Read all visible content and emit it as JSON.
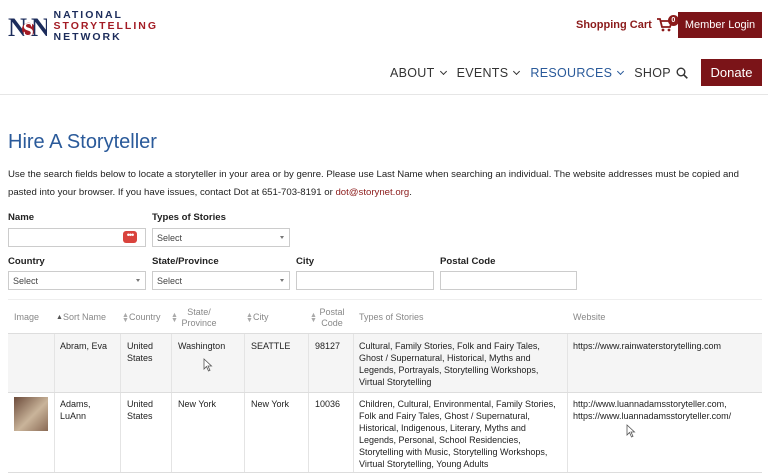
{
  "header": {
    "logo": {
      "line1": "NATIONAL",
      "line2": "STORYTELLING",
      "line3": "NETWORK"
    },
    "cart_label": "Shopping Cart",
    "cart_count": "0",
    "member_login": "Member Login",
    "nav": [
      {
        "label": "ABOUT",
        "dropdown": true
      },
      {
        "label": "EVENTS",
        "dropdown": true
      },
      {
        "label": "RESOURCES",
        "dropdown": true,
        "active": true
      },
      {
        "label": "SHOP",
        "dropdown": false
      }
    ],
    "donate": "Donate",
    "colors": {
      "brand_red": "#7b1418",
      "brand_blue": "#2a5a9a"
    }
  },
  "main": {
    "title": "Hire A Storyteller",
    "intro_text": "Use the search fields below to locate a storyteller in your area or by genre. Please use Last Name when searching an individual. The website addresses must be copied and pasted into your browser. If you have issues, contact Dot at 651-703-8191 or ",
    "intro_email": "dot@storynet.org",
    "intro_end": "."
  },
  "filters": {
    "name_label": "Name",
    "name_value": "",
    "types_label": "Types of Stories",
    "types_value": "Select",
    "country_label": "Country",
    "country_value": "Select",
    "state_label": "State/Province",
    "state_value": "Select",
    "city_label": "City",
    "city_value": "",
    "postal_label": "Postal Code",
    "postal_value": ""
  },
  "table": {
    "headers": {
      "image": "Image",
      "sort_name": "Sort Name",
      "country": "Country",
      "state": "State/ Province",
      "city": "City",
      "postal": "Postal Code",
      "types": "Types of Stories",
      "website": "Website"
    },
    "rows": [
      {
        "name": "Abram, Eva",
        "country": "United States",
        "state": "Washington",
        "city": "SEATTLE",
        "postal": "98127",
        "types": "Cultural, Family Stories, Folk and Fairy Tales, Ghost / Supernatural, Historical, Myths and Legends, Portrayals, Storytelling Workshops, Virtual Storytelling",
        "website": "https://www.rainwaterstorytelling.com"
      },
      {
        "name": "Adams, LuAnn",
        "country": "United States",
        "state": "New York",
        "city": "New York",
        "postal": "10036",
        "types": "Children, Cultural, Environmental, Family Stories, Folk and Fairy Tales, Ghost / Supernatural, Historical, Indigenous, Literary, Myths and Legends, Personal, School Residencies, Storytelling with Music, Storytelling Workshops, Virtual Storytelling, Young Adults",
        "website": "http://www.luannadamsstoryteller.com, https://www.luannadamsstoryteller.com/"
      }
    ]
  }
}
